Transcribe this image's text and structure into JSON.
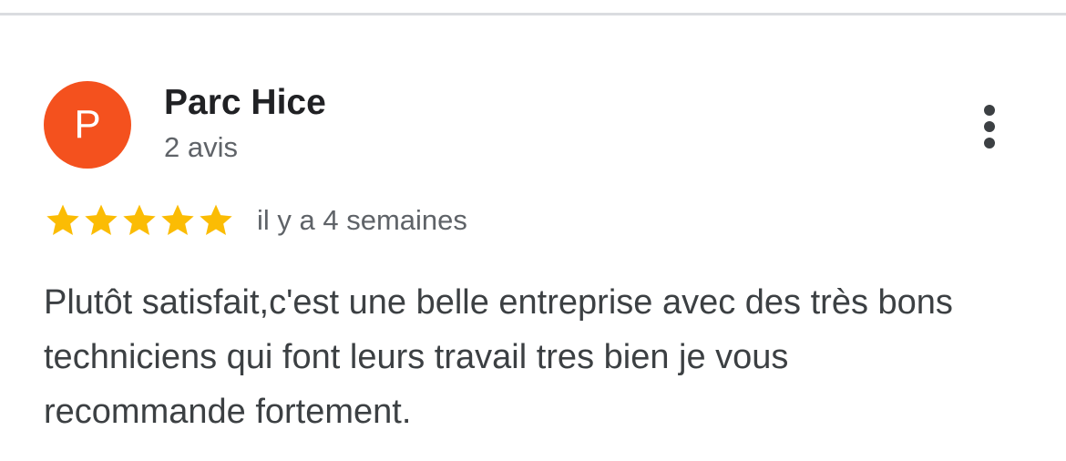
{
  "review": {
    "author": {
      "initial": "P",
      "name": "Parc Hice",
      "meta": "2 avis",
      "avatar_color": "#f4511e"
    },
    "rating": 5,
    "rating_max": 5,
    "star_color": "#fbbc04",
    "date": "il y a 4 semaines",
    "text": "Plutôt satisfait,c'est une belle entreprise avec des très bons techniciens qui font leurs travail tres bien je vous recommande fortement."
  },
  "icons": {
    "more": "more-vertical-icon",
    "star": "star-icon"
  }
}
